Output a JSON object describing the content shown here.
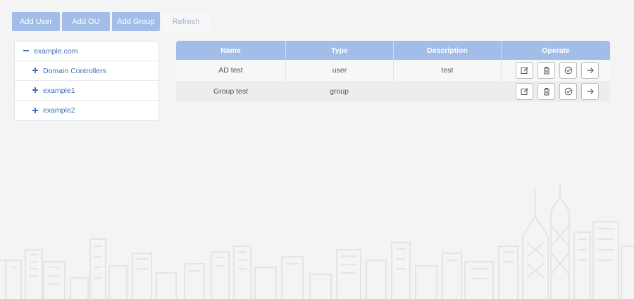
{
  "toolbar": {
    "add_user": "Add User",
    "add_ou": "Add OU",
    "add_group": "Add Group",
    "refresh": "Refresh"
  },
  "tree": {
    "root": "example.com",
    "children": [
      "Domain Controllers",
      "example1",
      "example2"
    ]
  },
  "table": {
    "headers": [
      "Name",
      "Type",
      "Description",
      "Operate"
    ],
    "rows": [
      {
        "name": "AD test",
        "type": "user",
        "description": "test"
      },
      {
        "name": "Group test",
        "type": "group",
        "description": ""
      }
    ]
  },
  "icons": {
    "tree_root": "minus-icon",
    "tree_child": "plus-icon",
    "operations": [
      "edit-icon",
      "trash-icon",
      "check-circle-icon",
      "arrow-right-icon"
    ]
  },
  "colors": {
    "accent": "#a3bde9",
    "link": "#3f6fb8",
    "background": "#f4f4f4"
  }
}
